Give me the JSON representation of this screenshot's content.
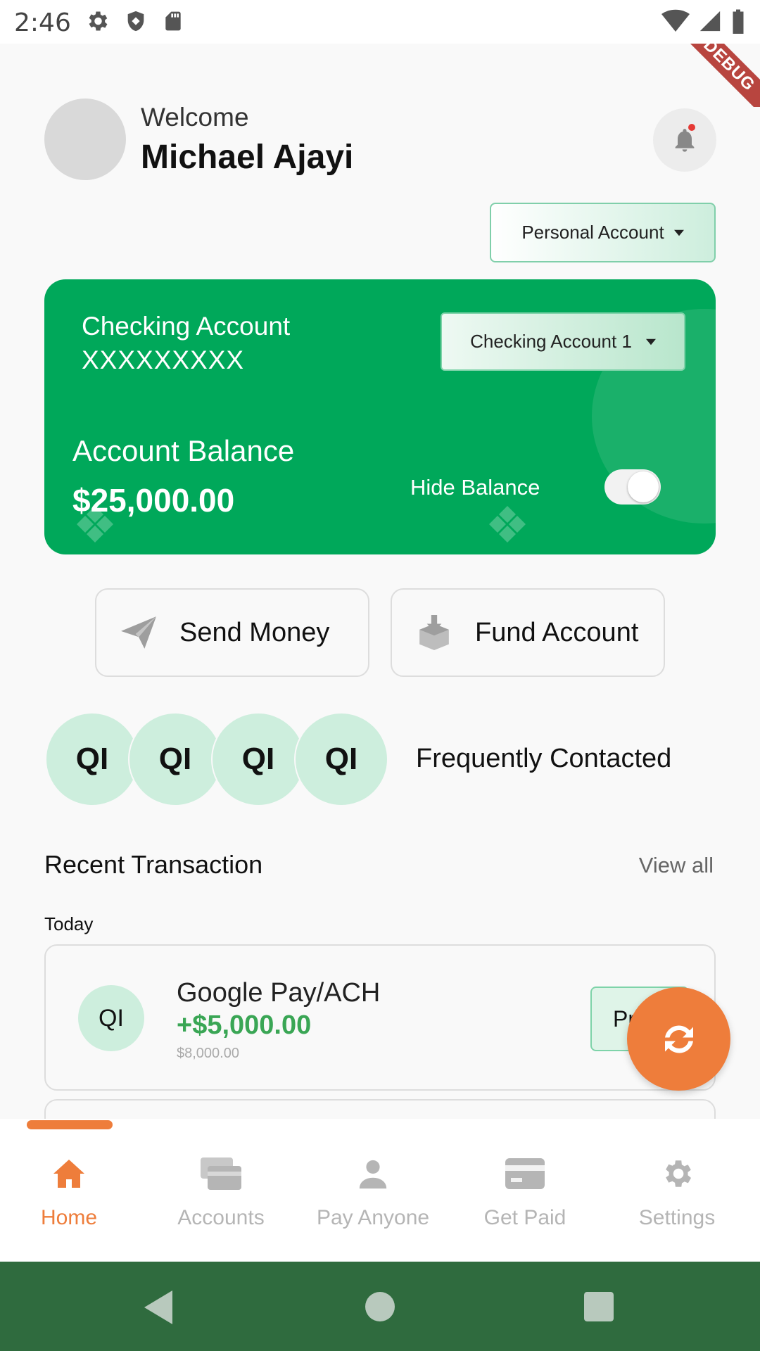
{
  "status_bar": {
    "time": "2:46"
  },
  "debug_banner": "DEBUG",
  "header": {
    "welcome": "Welcome",
    "user_name": "Michael Ajayi"
  },
  "account_type_dropdown": {
    "selected": "Personal Account"
  },
  "card": {
    "account_type": "Checking Account",
    "account_number": "XXXXXXXXX",
    "account_dropdown": "Checking Account 1",
    "balance_label": "Account Balance",
    "balance": "$25,000.00",
    "hide_balance_label": "Hide Balance",
    "hide_balance_on": true
  },
  "actions": {
    "send_money": "Send Money",
    "fund_account": "Fund Account"
  },
  "frequent": {
    "contacts": [
      "QI",
      "QI",
      "QI",
      "QI"
    ],
    "label": "Frequently Contacted"
  },
  "recent": {
    "title": "Recent Transaction",
    "view_all": "View all",
    "group_label": "Today",
    "transactions": [
      {
        "initials": "QI",
        "name": "Google Pay/ACH",
        "amount": "+$5,000.00",
        "balance": "$8,000.00",
        "status": "Pr"
      }
    ]
  },
  "bottom_nav": {
    "items": [
      {
        "label": "Home",
        "icon": "home-icon",
        "active": true
      },
      {
        "label": "Accounts",
        "icon": "accounts-icon",
        "active": false
      },
      {
        "label": "Pay Anyone",
        "icon": "person-icon",
        "active": false
      },
      {
        "label": "Get Paid",
        "icon": "card-icon",
        "active": false
      },
      {
        "label": "Settings",
        "icon": "gear-icon",
        "active": false
      }
    ]
  },
  "colors": {
    "brand_green": "#00a85a",
    "accent_orange": "#ee7d3b",
    "amount_green": "#3aa655",
    "system_nav": "#2f6b3e"
  }
}
